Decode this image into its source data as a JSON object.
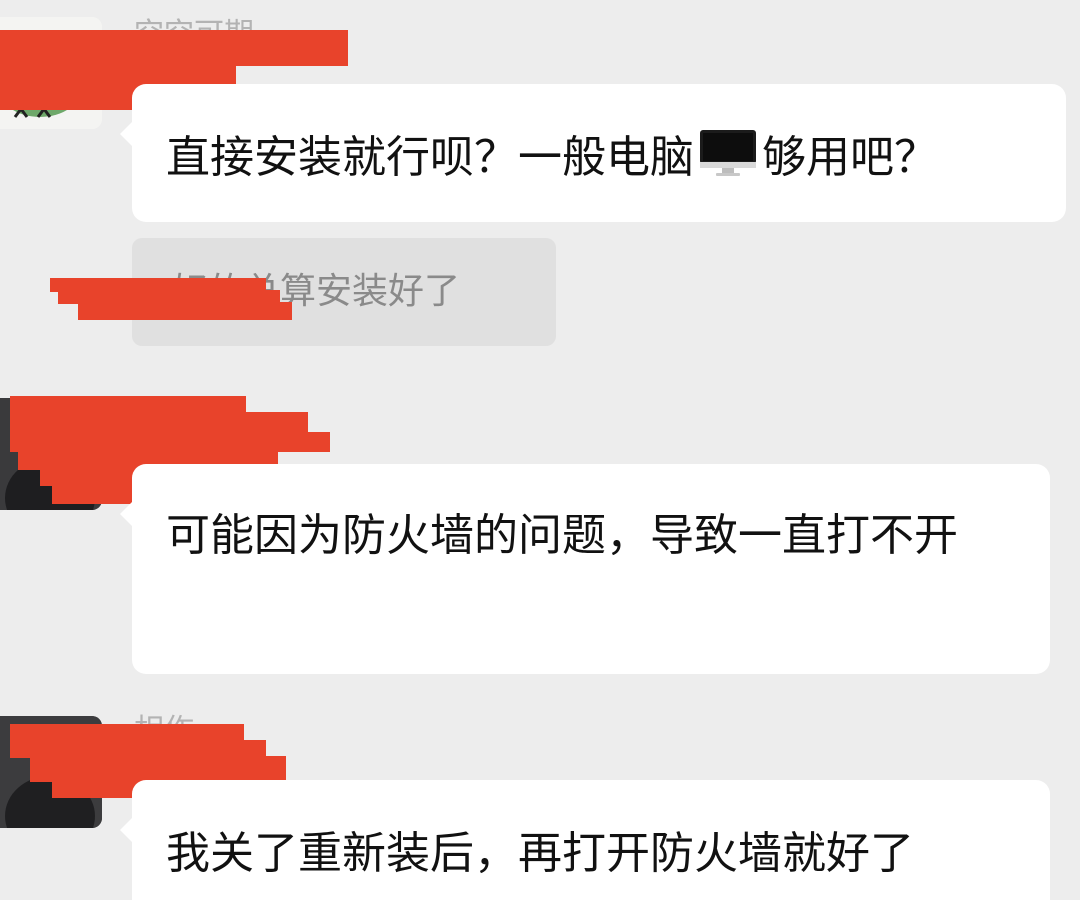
{
  "messages": [
    {
      "sender": "空空可期",
      "text_before_icon": "直接安装就行呗？一般电脑",
      "icon": "monitor-icon",
      "text_after_icon": "够用吧？"
    },
    {
      "quote_prefix": "好的",
      "quote_text": "总算安装好了"
    },
    {
      "sender": "",
      "text": "可能因为防火墙的问题，导致一直打不开"
    },
    {
      "sender": "相作",
      "text": "我关了重新装后，再打开防火墙就好了"
    }
  ],
  "colors": {
    "background": "#ededed",
    "bubble": "#ffffff",
    "quote_bubble": "#e0e0e0",
    "redaction": "#e8432b"
  }
}
